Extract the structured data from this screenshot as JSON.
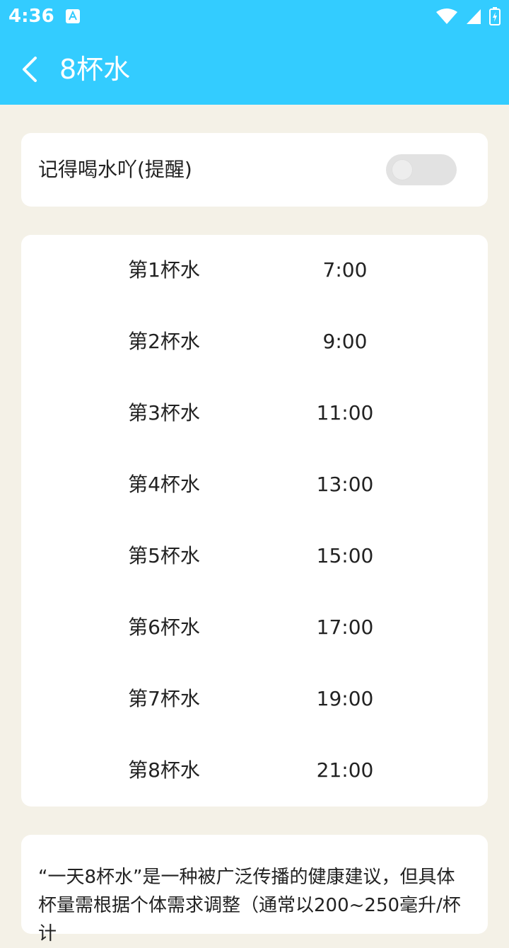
{
  "statusbar": {
    "time": "4:36"
  },
  "appbar": {
    "title": "8杯水"
  },
  "reminder": {
    "label": "记得喝水吖(提醒)",
    "enabled": false
  },
  "schedule": {
    "rows": [
      {
        "label": "第1杯水",
        "time": "7:00"
      },
      {
        "label": "第2杯水",
        "time": "9:00"
      },
      {
        "label": "第3杯水",
        "time": "11:00"
      },
      {
        "label": "第4杯水",
        "time": "13:00"
      },
      {
        "label": "第5杯水",
        "time": "15:00"
      },
      {
        "label": "第6杯水",
        "time": "17:00"
      },
      {
        "label": "第7杯水",
        "time": "19:00"
      },
      {
        "label": "第8杯水",
        "time": "21:00"
      }
    ]
  },
  "info": {
    "text": "“一天8杯水”是一种被广泛传播的健康建议，但具体杯量需根据个体需求调整（通常以200~250毫升/杯计"
  },
  "colors": {
    "accent": "#33CCFF",
    "background": "#F4F1E7",
    "card": "#FFFFFF"
  }
}
